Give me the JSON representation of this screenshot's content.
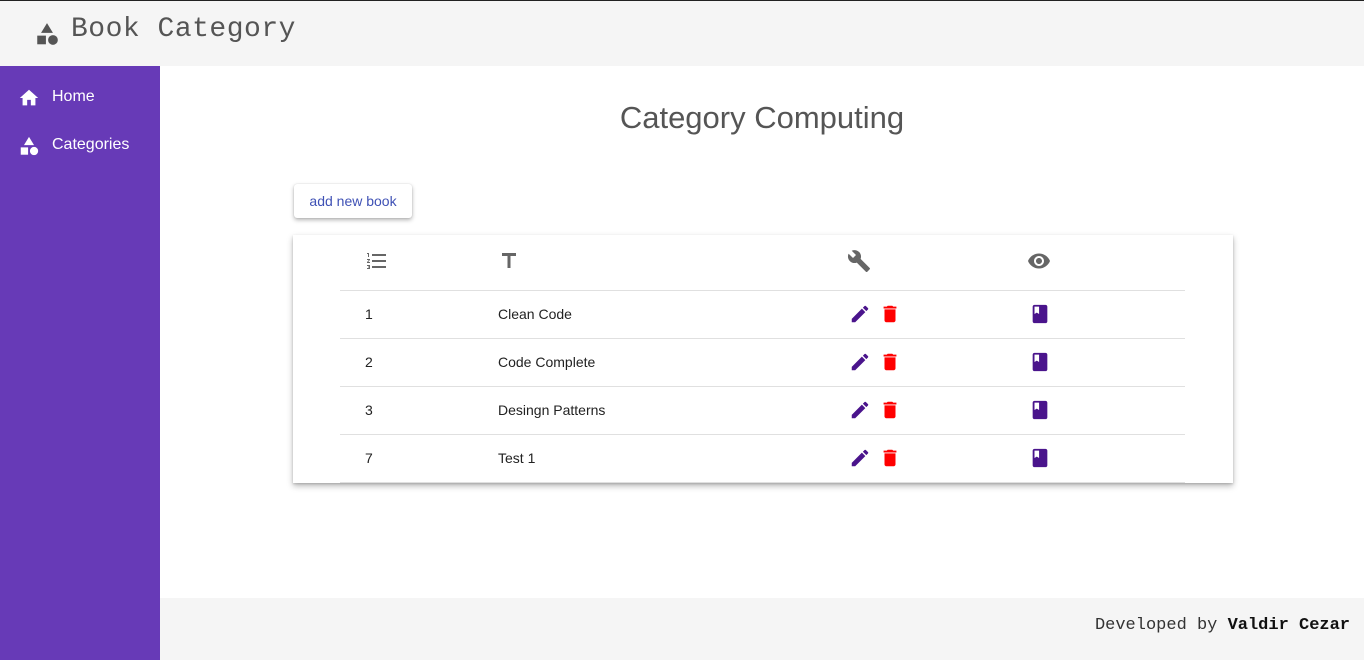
{
  "header": {
    "title": "Book Category",
    "logo_icon": "category-shapes-icon"
  },
  "sidebar": {
    "items": [
      {
        "label": "Home",
        "icon": "home-icon"
      },
      {
        "label": "Categories",
        "icon": "category-shapes-icon"
      }
    ]
  },
  "main": {
    "title": "Category Computing",
    "add_button_label": "add new book",
    "table": {
      "header_icons": [
        "numbered-list-icon",
        "text-title-icon",
        "wrench-icon",
        "eye-icon"
      ],
      "rows": [
        {
          "id": "1",
          "title": "Clean Code"
        },
        {
          "id": "2",
          "title": "Code Complete"
        },
        {
          "id": "3",
          "title": "Desingn Patterns"
        },
        {
          "id": "7",
          "title": "Test 1"
        }
      ]
    }
  },
  "footer": {
    "prefix": "Developed by",
    "author": "Valdir Cezar"
  },
  "colors": {
    "sidebar": "#673ab7",
    "edit_icon": "#4a148c",
    "delete_icon": "#ff0000",
    "view_icon": "#4a148c",
    "button_text": "#3f51b5"
  }
}
